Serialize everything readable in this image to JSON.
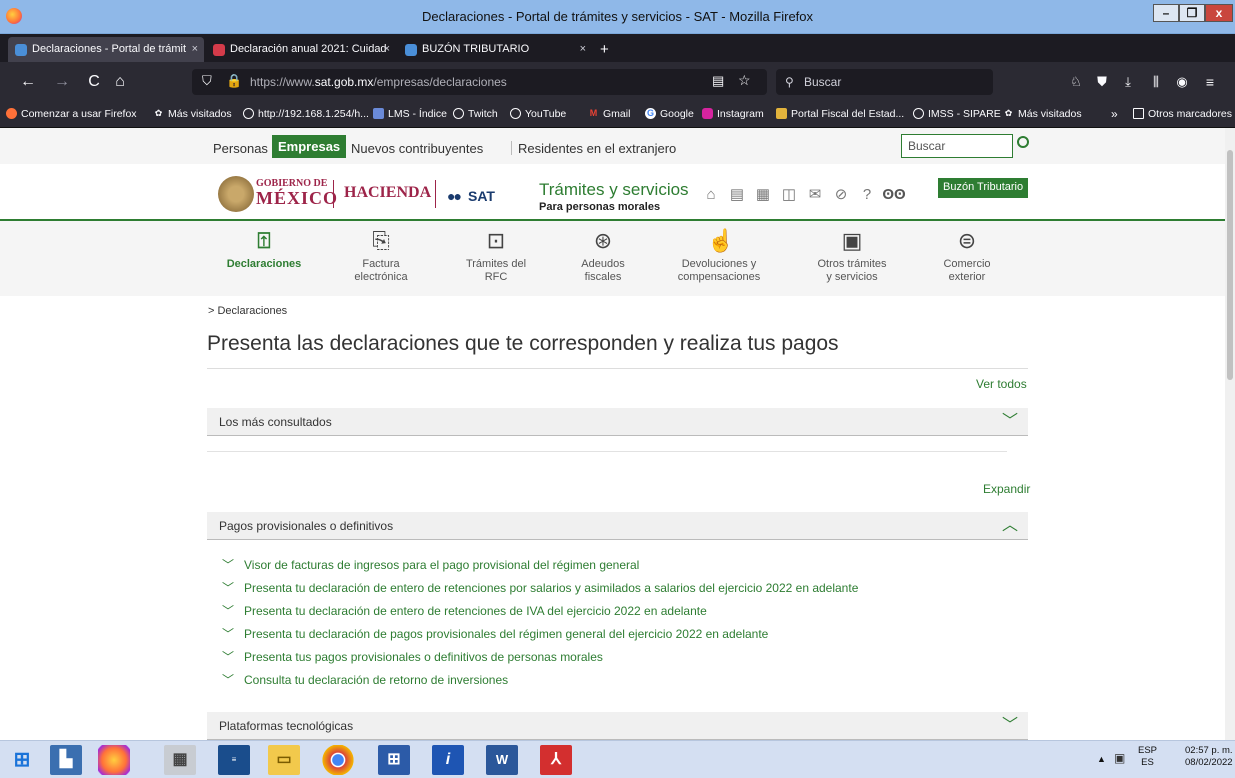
{
  "window": {
    "title": "Declaraciones - Portal de trámites y servicios - SAT - Mozilla Firefox",
    "minimize": "–",
    "maximize": "❐",
    "close": "x"
  },
  "tabs": [
    {
      "label": "Declaraciones - Portal de trámit",
      "close": "×"
    },
    {
      "label": "Declaración anual 2021: Cuidad",
      "close": "×"
    },
    {
      "label": "BUZÓN TRIBUTARIO",
      "close": "×"
    }
  ],
  "new_tab": "+",
  "nav": {
    "back": "←",
    "forward": "→",
    "reload": "C",
    "home": "⌂",
    "url_prefix": "https://www.",
    "url_domain": "sat.gob.mx",
    "url_path": "/empresas/declaraciones",
    "search_placeholder": "Buscar"
  },
  "bookmarks": [
    "Comenzar a usar Firefox",
    "Más visitados",
    "http://192.168.1.254/h...",
    "LMS - Índice",
    "Twitch",
    "YouTube",
    "Gmail",
    "Google",
    "Instagram",
    "Portal Fiscal del Estad...",
    "IMSS - SIPARE",
    "Más visitados"
  ],
  "bookmarks_more": "»",
  "other_bookmarks": "Otros marcadores",
  "topnav": {
    "personas": "Personas",
    "empresas": "Empresas",
    "nuevos": "Nuevos contribuyentes",
    "residentes": "Residentes en el extranjero",
    "search_placeholder": "Buscar"
  },
  "header": {
    "gob_line1": "GOBIERNO DE",
    "gob_line2": "MÉXICO",
    "hacienda": "HACIENDA",
    "sat": "SAT",
    "tramites": "Trámites y servicios",
    "subtitle": "Para personas morales",
    "buzon": "Buzón Tributario"
  },
  "categories": [
    {
      "l1": "Declaraciones",
      "l2": ""
    },
    {
      "l1": "Factura",
      "l2": "electrónica"
    },
    {
      "l1": "Trámites del",
      "l2": "RFC"
    },
    {
      "l1": "Adeudos",
      "l2": "fiscales"
    },
    {
      "l1": "Devoluciones y",
      "l2": "compensaciones"
    },
    {
      "l1": "Otros trámites",
      "l2": "y servicios"
    },
    {
      "l1": "Comercio",
      "l2": "exterior"
    }
  ],
  "breadcrumb": "> Declaraciones",
  "page_title": "Presenta las declaraciones que te corresponden y realiza tus pagos",
  "ver_todos": "Ver todos",
  "expandir": "Expandir",
  "section1": "Los más consultados",
  "section2": "Pagos provisionales o definitivos",
  "section3": "Plataformas tecnológicas",
  "items": [
    "Visor de facturas de ingresos para el pago provisional del régimen general",
    "Presenta tu declaración de entero de retenciones por salarios y asimilados a salarios del ejercicio 2022 en adelante",
    "Presenta tu declaración de entero de retenciones de IVA del ejercicio 2022 en adelante",
    "Presenta tu declaración de pagos provisionales del régimen general del ejercicio 2022 en adelante",
    "Presenta tus pagos provisionales o definitivos de personas morales",
    "Consulta tu declaración de retorno de inversiones"
  ],
  "tray": {
    "lang1": "ESP",
    "lang2": "ES",
    "time": "02:57 p. m.",
    "date": "08/02/2022"
  },
  "colors": {
    "accent_green": "#2e7d32",
    "gob_red": "#9d2449"
  }
}
